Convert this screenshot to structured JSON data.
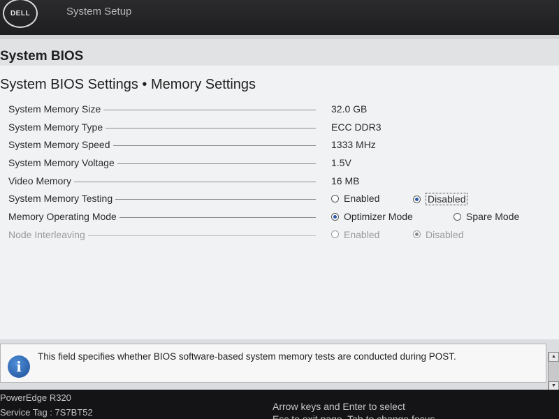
{
  "header": {
    "logo_text": "DELL",
    "app_title": "System Setup"
  },
  "section_title": "System BIOS",
  "page_title": "System BIOS Settings • Memory Settings",
  "settings": {
    "memory_size": {
      "label": "System Memory Size",
      "value": "32.0 GB"
    },
    "memory_type": {
      "label": "System Memory Type",
      "value": "ECC DDR3"
    },
    "memory_speed": {
      "label": "System Memory Speed",
      "value": "1333 MHz"
    },
    "memory_voltage": {
      "label": "System Memory Voltage",
      "value": "1.5V"
    },
    "video_memory": {
      "label": "Video Memory",
      "value": "16 MB"
    },
    "memory_testing": {
      "label": "System Memory Testing",
      "options": [
        "Enabled",
        "Disabled"
      ],
      "selected": "Disabled"
    },
    "operating_mode": {
      "label": "Memory Operating Mode",
      "options": [
        "Optimizer Mode",
        "Spare Mode"
      ],
      "selected": "Optimizer Mode"
    },
    "node_interleaving": {
      "label": "Node Interleaving",
      "options": [
        "Enabled",
        "Disabled"
      ],
      "selected": "Disabled",
      "state": "disabled"
    }
  },
  "help": {
    "icon": "info-icon",
    "text": "This field specifies whether BIOS software-based system memory tests are conducted during POST."
  },
  "footer": {
    "model": "PowerEdge R320",
    "service_tag": "Service Tag : 7S7BT52",
    "hint_line1": "Arrow keys and Enter to select",
    "hint_line2": "Esc to exit page, Tab to change focus"
  },
  "colors": {
    "topbar": "#1e1e20",
    "panel": "#f1f2f3",
    "radio_selected": "#2c5aa8",
    "disabled_text": "#9a9a9a"
  }
}
